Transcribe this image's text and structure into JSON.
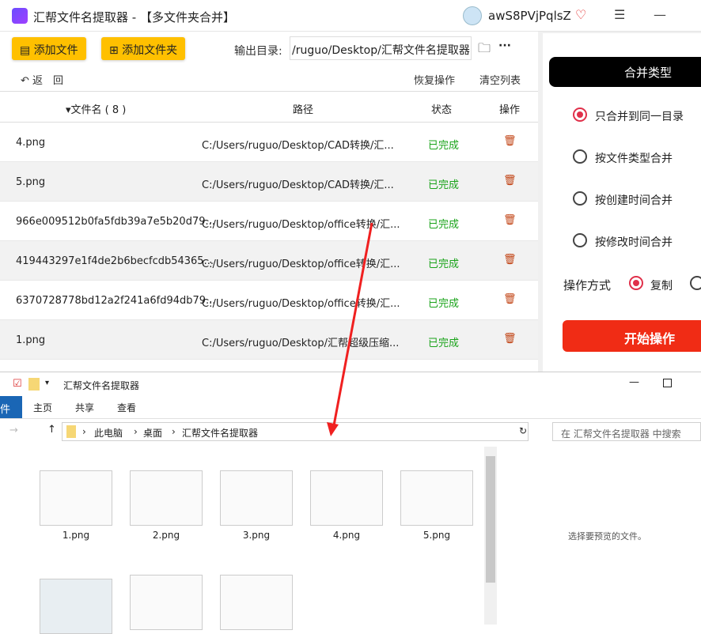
{
  "app": {
    "title": "汇帮文件名提取器 - 【多文件夹合并】",
    "username": "awS8PVjPqlsZ"
  },
  "toolbar": {
    "add_file": "添加文件",
    "add_folder": "添加文件夹",
    "output_label": "输出目录:",
    "output_value": "/ruguo/Desktop/汇帮文件名提取器",
    "more": "···",
    "back": "返　回",
    "restore": "恢复操作",
    "clear": "清空列表"
  },
  "table": {
    "headers": {
      "name": "▾文件名 ( 8 )",
      "path": "路径",
      "status": "状态",
      "action": "操作"
    },
    "rows": [
      {
        "name": "4.png",
        "path": "C:/Users/ruguo/Desktop/CAD转换/汇...",
        "status": "已完成"
      },
      {
        "name": "5.png",
        "path": "C:/Users/ruguo/Desktop/CAD转换/汇...",
        "status": "已完成"
      },
      {
        "name": "966e009512b0fa5fdb39a7e5b20d79...",
        "path": "C:/Users/ruguo/Desktop/office转换/汇...",
        "status": "已完成"
      },
      {
        "name": "419443297e1f4de2b6becfcdb54365...",
        "path": "C:/Users/ruguo/Desktop/office转换/汇...",
        "status": "已完成"
      },
      {
        "name": "6370728778bd12a2f241a6fd94db79...",
        "path": "C:/Users/ruguo/Desktop/office转换/汇...",
        "status": "已完成"
      },
      {
        "name": "1.png",
        "path": "C:/Users/ruguo/Desktop/汇帮超级压缩...",
        "status": "已完成"
      }
    ]
  },
  "merge": {
    "title": "合并类型",
    "options": [
      "只合并到同一目录",
      "按文件类型合并",
      "按创建时间合并",
      "按修改时间合并"
    ],
    "selected": 0,
    "mode_label": "操作方式",
    "mode_option": "复制",
    "start": "开始操作"
  },
  "explorer": {
    "title": "汇帮文件名提取器",
    "tabs": [
      "件",
      "主页",
      "共享",
      "查看"
    ],
    "breadcrumb": [
      "此电脑",
      "桌面",
      "汇帮文件名提取器"
    ],
    "search_placeholder": "在 汇帮文件名提取器 中搜索",
    "preview_text": "选择要预览的文件。",
    "files": [
      "1.png",
      "2.png",
      "3.png",
      "4.png",
      "5.png"
    ]
  },
  "colors": {
    "accent": "#ffc000",
    "danger": "#f02c15",
    "success": "#1aa31a"
  }
}
